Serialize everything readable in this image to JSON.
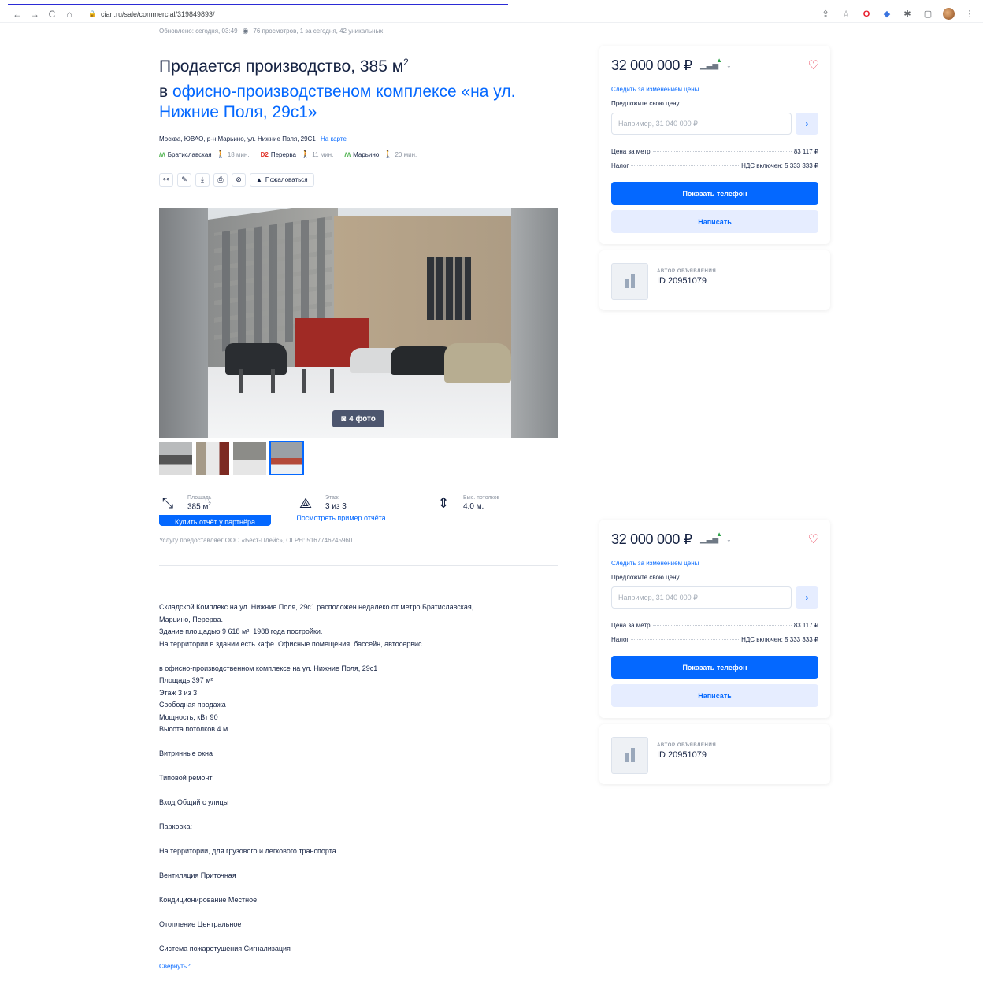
{
  "browser": {
    "url": "cian.ru/sale/commercial/319849893/"
  },
  "meta": {
    "updated": "Обновлено: сегодня, 03:49",
    "views": "76 просмотров, 1 за сегодня, 42 уникальных"
  },
  "listing": {
    "title": "Продается производство, 385 м",
    "title_sup": "2",
    "subtitle_prefix": "в ",
    "subtitle_link": "офисно-производственом комплексе «на ул. Нижние Поля, 29с1»",
    "address": "Москва, ЮВАО, р-н Марьино, ул. Нижние Поля, 29С1",
    "map_link": "На карте",
    "metro": [
      {
        "line": "M",
        "name": "Братиславская",
        "time": "18 мин."
      },
      {
        "line": "D2",
        "name": "Перерва",
        "time": "11 мин."
      },
      {
        "line": "M",
        "name": "Марьино",
        "time": "20 мин."
      }
    ],
    "complain_label": "Пожаловаться",
    "photo_count": "4 фото"
  },
  "params": {
    "area_label": "Площадь",
    "area_value": "385 м",
    "area_sup": "2",
    "floor_label": "Этаж",
    "floor_value": "3 из 3",
    "ceiling_label": "Выс. потолков",
    "ceiling_value": "4.0 м."
  },
  "report": {
    "buy_label": "Купить отчёт у партнёра",
    "sample_label": "Посмотреть пример отчёта",
    "provider": "Услугу предоставляет ООО «Бест-Плейс», ОГРН: 5167746245960"
  },
  "description": {
    "lines": [
      "Складской Комплекс на ул. Нижние Поля, 29с1  расположен недалеко от метро Братиславская,",
      "Марьино, Перерва.",
      "Здание площадью 9 618 м², 1988 года постройки.",
      "На территории в здании есть кафе. Офисные помещения, бассейн, автосервис.",
      "",
      "в офисно-производственном комплексе на ул. Нижние Поля, 29с1",
      "Площадь 397 м²",
      "Этаж 3 из 3",
      "Свободная продажа",
      "Мощность, кВт 90",
      "Высота потолков 4 м",
      "",
      "Витринные окна",
      "",
      "Типовой ремонт",
      "",
      "Вход Общий с улицы",
      "",
      "Парковка:",
      "",
      "На территории, для грузового и легкового транспорта",
      "",
      "Вентиляция Приточная",
      "",
      "Кондиционирование Местное",
      "",
      "Отопление Центральное",
      "",
      "Система пожаротушения Сигнализация"
    ],
    "collapse_label": "Свернуть"
  },
  "price_card": {
    "price": "32 000 000 ₽",
    "follow_label": "Следить за изменением цены",
    "offer_label": "Предложите свою цену",
    "offer_placeholder": "Например, 31 040 000 ₽",
    "per_meter_label": "Цена за метр",
    "per_meter_value": "83 117 ₽",
    "tax_label": "Налог",
    "tax_value": "НДС включен: 5 333 333 ₽",
    "phone_button": "Показать телефон",
    "write_button": "Написать"
  },
  "author_card": {
    "role": "АВТОР ОБЪЯВЛЕНИЯ",
    "id": "ID 20951079"
  },
  "colors": {
    "accent": "#0468ff",
    "text": "#152242",
    "muted": "#8c94a1",
    "heart": "#e8314a"
  }
}
